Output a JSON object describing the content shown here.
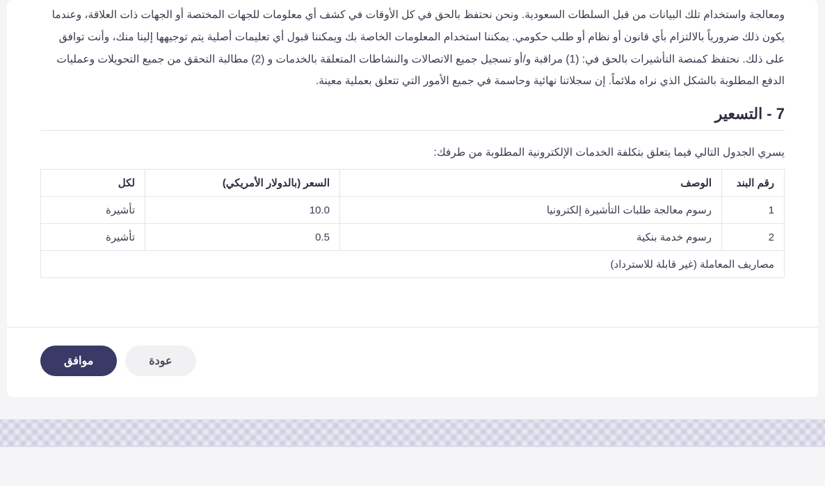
{
  "paragraph": "ومعالجة واستخدام تلك البيانات من قبل السلطات السعودية. ونحن نحتفظ بالحق في كل الأوقات في كشف أي معلومات للجهات المختصة أو الجهات ذات العلاقة، وعندما يكون ذلك ضرورياً بالالتزام بأي قانون أو نظام أو طلب حكومي. يمكننا استخدام المعلومات الخاصة بك ويمكننا قبول أي تعليمات أصلية يتم توجيهها إلينا منك، وأنت توافق على ذلك. نحتفظ كمنصة التأشيرات بالحق في: (1) مراقبة و/أو تسجيل جميع الاتصالات والنشاطات المتعلقة بالخدمات و (2) مطالبة التحقق من جميع التحويلات وعمليات الدفع المطلوبة بالشكل الذي نراه ملائماً. إن سجلاتنا نهائية وحاسمة في جميع الأمور التي تتعلق بعملية معينة.",
  "section": {
    "title": "7 - التسعير",
    "intro": "يسري الجدول التالي فيما يتعلق بتكلفة الخدمات الإلكترونية المطلوبة من طرفك:"
  },
  "table": {
    "headers": {
      "num": "رقم البند",
      "desc": "الوصف",
      "price": "السعر (بالدولار الأمريكي)",
      "per": "لكل"
    },
    "rows": [
      {
        "num": "1",
        "desc": "رسوم معالجة طلبات التأشيرة إلكترونيا",
        "price": "10.0",
        "per": "تأشيرة"
      },
      {
        "num": "2",
        "desc": "رسوم خدمة بنكية",
        "price": "0.5",
        "per": "تأشيرة"
      }
    ],
    "footnote": "مصاريف المعاملة (غير قابلة للاسترداد)"
  },
  "buttons": {
    "back": "عودة",
    "agree": "موافق"
  }
}
